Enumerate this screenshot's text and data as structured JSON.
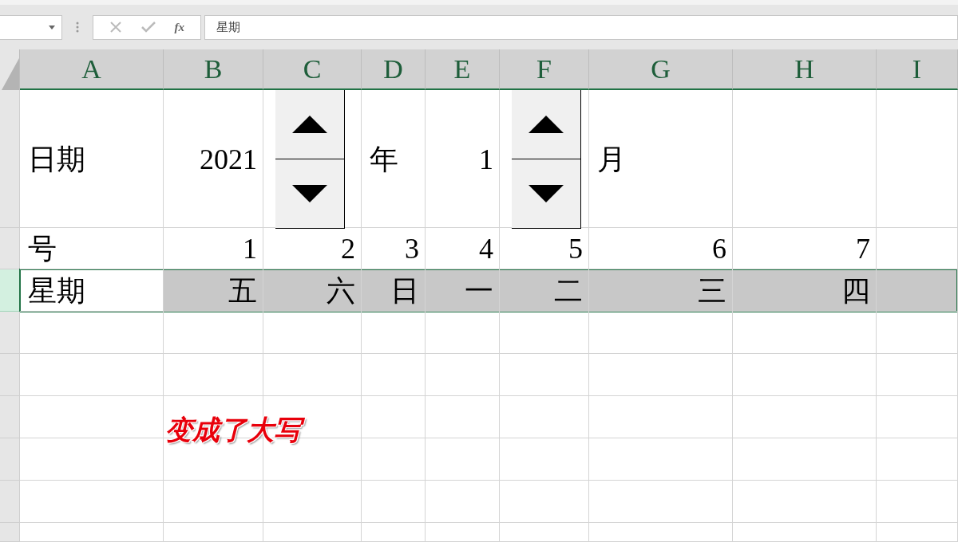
{
  "formula_bar": {
    "fx": "fx",
    "value": "星期"
  },
  "columns": [
    "A",
    "B",
    "C",
    "D",
    "E",
    "F",
    "G",
    "H",
    "I"
  ],
  "rows": [
    {
      "selected": false,
      "cells": [
        {
          "text": "日期",
          "kind": "label"
        },
        {
          "text": "2021",
          "kind": "value"
        },
        {
          "kind": "spinner"
        },
        {
          "text": "年",
          "kind": "label"
        },
        {
          "text": "1",
          "kind": "value"
        },
        {
          "kind": "spinner"
        },
        {
          "text": "月",
          "kind": "label"
        },
        {},
        {}
      ]
    },
    {
      "selected": false,
      "cells": [
        {
          "text": "号",
          "kind": "label"
        },
        {
          "text": "1",
          "kind": "value"
        },
        {
          "text": "2",
          "kind": "value"
        },
        {
          "text": "3",
          "kind": "value"
        },
        {
          "text": "4",
          "kind": "value"
        },
        {
          "text": "5",
          "kind": "value"
        },
        {
          "text": "6",
          "kind": "value"
        },
        {
          "text": "7",
          "kind": "value"
        },
        {}
      ]
    },
    {
      "selected": true,
      "cells": [
        {
          "text": "星期",
          "kind": "label"
        },
        {
          "text": "五",
          "kind": "value",
          "shaded": true
        },
        {
          "text": "六",
          "kind": "value",
          "shaded": true
        },
        {
          "text": "日",
          "kind": "value",
          "shaded": true
        },
        {
          "text": "一",
          "kind": "value",
          "shaded": true
        },
        {
          "text": "二",
          "kind": "value",
          "shaded": true
        },
        {
          "text": "三",
          "kind": "value",
          "shaded": true
        },
        {
          "text": "四",
          "kind": "value",
          "shaded": true
        },
        {
          "shaded": true
        }
      ]
    },
    {
      "selected": false,
      "cells": [
        {},
        {},
        {},
        {},
        {},
        {},
        {},
        {},
        {}
      ]
    },
    {
      "selected": false,
      "cells": [
        {},
        {},
        {},
        {},
        {},
        {},
        {},
        {},
        {}
      ]
    },
    {
      "selected": false,
      "cells": [
        {},
        {},
        {},
        {},
        {},
        {},
        {},
        {},
        {}
      ]
    },
    {
      "selected": false,
      "cells": [
        {},
        {},
        {},
        {},
        {},
        {},
        {},
        {},
        {}
      ]
    },
    {
      "selected": false,
      "cells": [
        {},
        {},
        {},
        {},
        {},
        {},
        {},
        {},
        {}
      ]
    },
    {
      "selected": false,
      "cells": [
        {},
        {},
        {},
        {},
        {},
        {},
        {},
        {},
        {}
      ]
    }
  ],
  "annotation": "变成了大写"
}
